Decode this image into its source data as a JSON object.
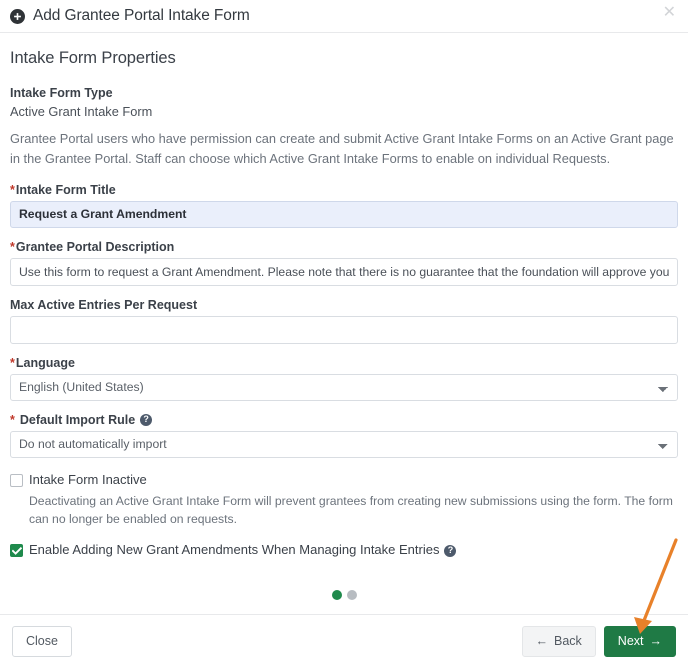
{
  "header": {
    "icon": "plus-circle-icon",
    "title": "Add Grantee Portal Intake Form",
    "close_label": "✕"
  },
  "main": {
    "section_title": "Intake Form Properties",
    "intake_form_type": {
      "label": "Intake Form Type",
      "value": "Active Grant Intake Form"
    },
    "type_description": "Grantee Portal users who have permission can create and submit Active Grant Intake Forms on an Active Grant page in the Grantee Portal. Staff can choose which Active Grant Intake Forms to enable on individual Requests.",
    "fields": {
      "intake_form_title": {
        "label": "Intake Form Title",
        "required": true,
        "star": "*",
        "value": "Request a Grant Amendment",
        "placeholder": ""
      },
      "grantee_portal_description": {
        "label": "Grantee Portal Description",
        "required": true,
        "star": "*",
        "value": "Use this form to request a Grant Amendment. Please note that there is no guarantee that the foundation will approve your requ",
        "placeholder": ""
      },
      "max_active_entries": {
        "label": "Max Active Entries Per Request",
        "required": false,
        "value": "",
        "placeholder": ""
      },
      "language": {
        "label": "Language",
        "required": true,
        "star": "*",
        "value": "English (United States)",
        "options": [
          "English (United States)"
        ]
      },
      "default_import_rule": {
        "label": "Default Import Rule",
        "required": true,
        "star": "*",
        "help_icon": "help-circle-icon",
        "help_glyph": "?",
        "value": "Do not automatically import",
        "options": [
          "Do not automatically import"
        ]
      }
    },
    "checkboxes": [
      {
        "name": "intake-form-inactive",
        "label": "Intake Form Inactive",
        "checked": false,
        "help_text": "Deactivating an Active Grant Intake Form will prevent grantees from creating new submissions using the form. The form can no longer be enabled on requests."
      },
      {
        "name": "enable-adding-new-grant-amendments",
        "label": "Enable Adding New Grant Amendments When Managing Intake Entries",
        "checked": true,
        "help_icon": "help-circle-icon",
        "help_glyph": "?"
      }
    ],
    "pager": {
      "total": 2,
      "current": 1
    }
  },
  "footer": {
    "close_label": "Close",
    "back_label": "Back",
    "back_arrow": "←",
    "next_label": "Next",
    "next_arrow": "→"
  },
  "colors": {
    "accent_green": "#1f7a45",
    "dot_active": "#1f8a4c",
    "dot_inactive": "#b7bcc1",
    "required_star": "#c0392b",
    "highlight_field_bg": "#eaeffb",
    "annotation_arrow": "#e8812a",
    "help_icon_bg": "#4d5a6b"
  }
}
